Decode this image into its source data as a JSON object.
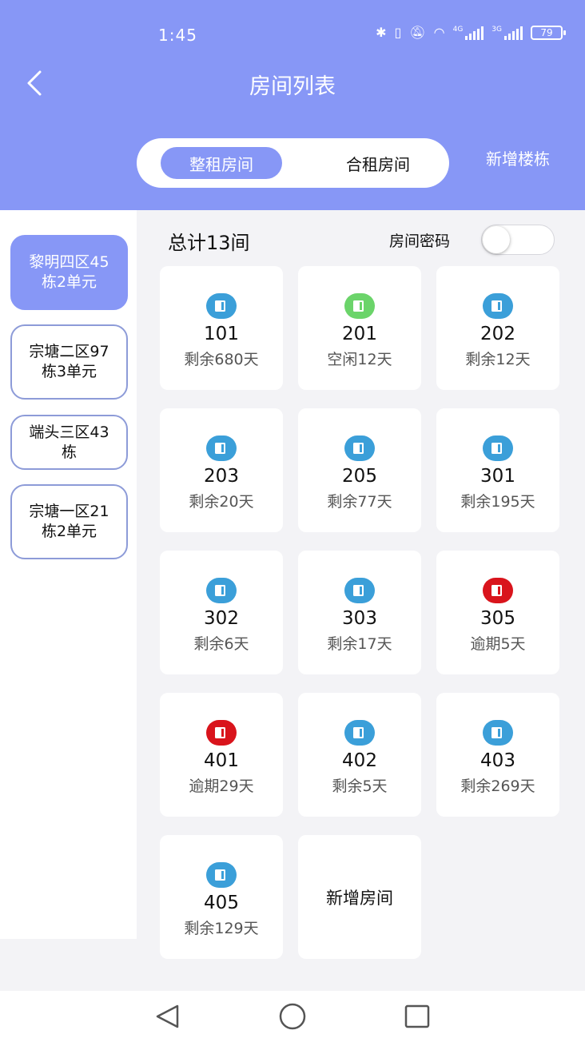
{
  "status": {
    "time": "1:45",
    "signal1_label": "4G",
    "signal2_label": "3G",
    "battery": "79"
  },
  "header": {
    "title": "房间列表",
    "add_building": "新增楼栋"
  },
  "tabs": [
    {
      "label": "整租房间",
      "active": true
    },
    {
      "label": "合租房间",
      "active": false
    }
  ],
  "buildings": [
    {
      "label": "黎明四区45栋2单元",
      "active": true
    },
    {
      "label": "宗塘二区97栋3单元",
      "active": false
    },
    {
      "label": "端头三区43栋",
      "active": false
    },
    {
      "label": "宗塘一区21栋2单元",
      "active": false
    }
  ],
  "summary": {
    "total": "总计13间",
    "password_label": "房间密码",
    "password_enabled": false
  },
  "colors": {
    "accent": "#8797f6",
    "normal": "#3b9fd9",
    "idle": "#6bd46a",
    "overdue": "#d9141c"
  },
  "rooms": [
    {
      "number": "101",
      "status": "剩余680天",
      "state": "normal"
    },
    {
      "number": "201",
      "status": "空闲12天",
      "state": "idle"
    },
    {
      "number": "202",
      "status": "剩余12天",
      "state": "normal"
    },
    {
      "number": "203",
      "status": "剩余20天",
      "state": "normal"
    },
    {
      "number": "205",
      "status": "剩余77天",
      "state": "normal"
    },
    {
      "number": "301",
      "status": "剩余195天",
      "state": "normal"
    },
    {
      "number": "302",
      "status": "剩余6天",
      "state": "normal"
    },
    {
      "number": "303",
      "status": "剩余17天",
      "state": "normal"
    },
    {
      "number": "305",
      "status": "逾期5天",
      "state": "overdue"
    },
    {
      "number": "401",
      "status": "逾期29天",
      "state": "overdue"
    },
    {
      "number": "402",
      "status": "剩余5天",
      "state": "normal"
    },
    {
      "number": "403",
      "status": "剩余269天",
      "state": "normal"
    },
    {
      "number": "405",
      "status": "剩余129天",
      "state": "normal"
    }
  ],
  "add_room": "新增房间"
}
